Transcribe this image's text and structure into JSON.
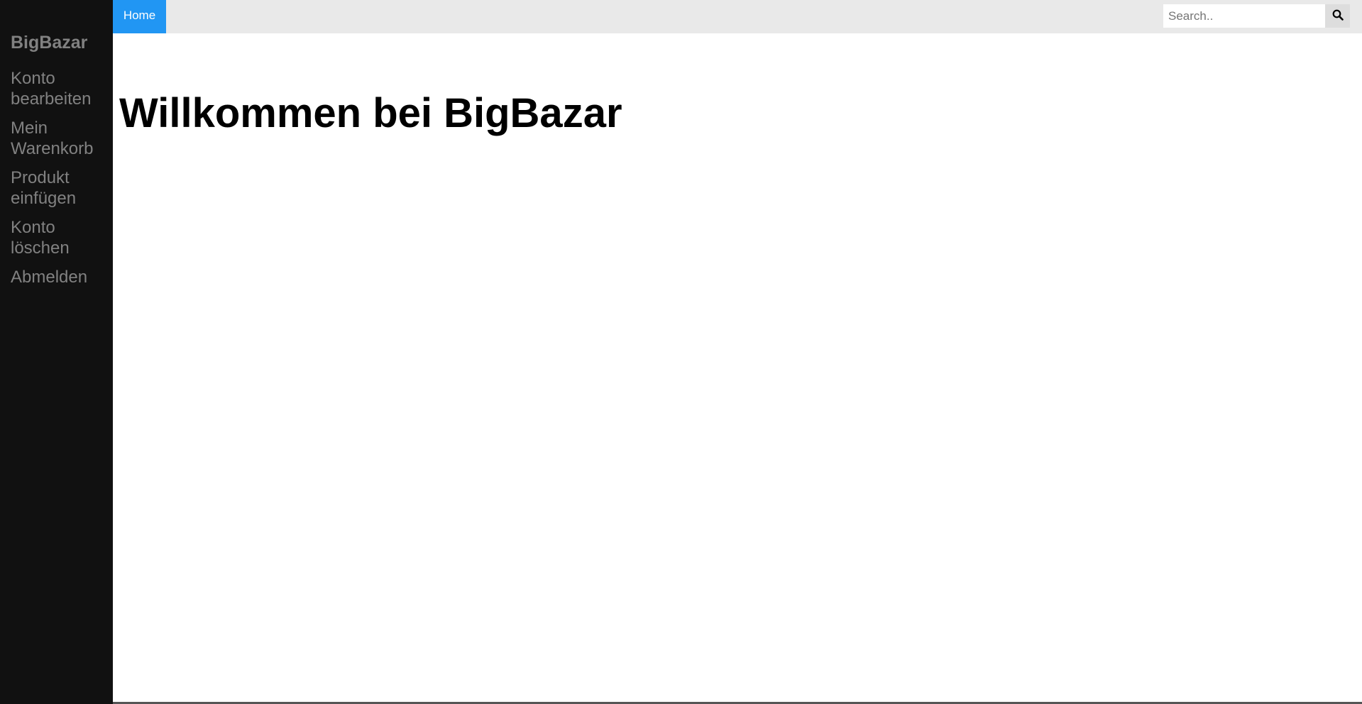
{
  "sidebar": {
    "brand": "BigBazar",
    "items": [
      {
        "label": "Konto bearbeiten"
      },
      {
        "label": "Mein Warenkorb"
      },
      {
        "label": "Produkt einfügen"
      },
      {
        "label": "Konto löschen"
      },
      {
        "label": "Abmelden"
      }
    ]
  },
  "topbar": {
    "home_label": "Home",
    "search": {
      "placeholder": "Search..",
      "value": "",
      "button_icon": "search-icon"
    }
  },
  "main": {
    "title": "Willkommen bei BigBazar"
  },
  "colors": {
    "sidebar_bg": "#111111",
    "sidebar_text": "#818181",
    "topbar_bg": "#e9e9e9",
    "home_tab_bg": "#2196f3"
  }
}
